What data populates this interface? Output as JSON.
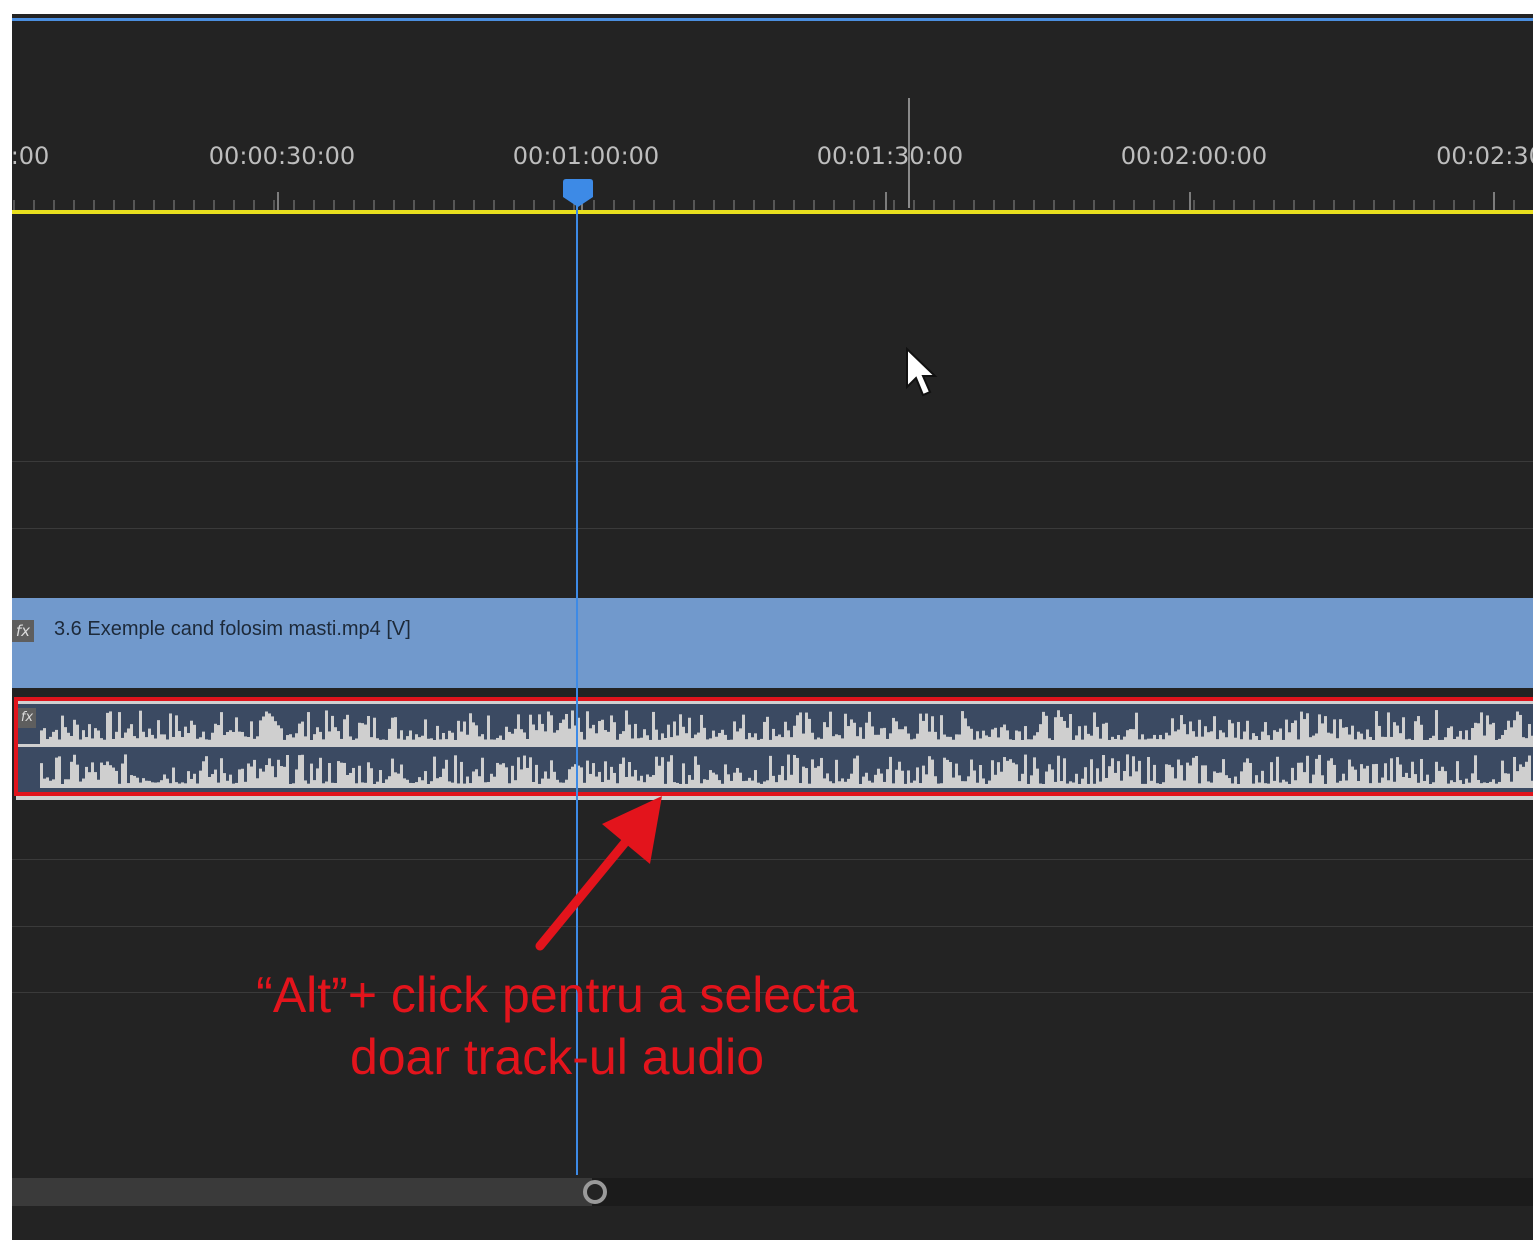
{
  "ruler": {
    "timecodes": [
      ":00",
      "00:00:30:00",
      "00:01:00:00",
      "00:01:30:00",
      "00:02:00:00",
      "00:02:30"
    ]
  },
  "video_clip": {
    "fx_badge": "fx",
    "name": "3.6 Exemple cand folosim masti.mp4 [V]"
  },
  "audio_clip": {
    "fx_badge": "fx"
  },
  "annotation": {
    "line1": "“Alt”+ click pentru a selecta",
    "line2": "doar track-ul audio"
  },
  "colors": {
    "panel_bg": "#232323",
    "work_area": "#e8df1e",
    "playhead": "#3d8ae6",
    "video_clip": "#7199cc",
    "audio_clip": "#3b4a62",
    "annotation": "#e3141c"
  }
}
